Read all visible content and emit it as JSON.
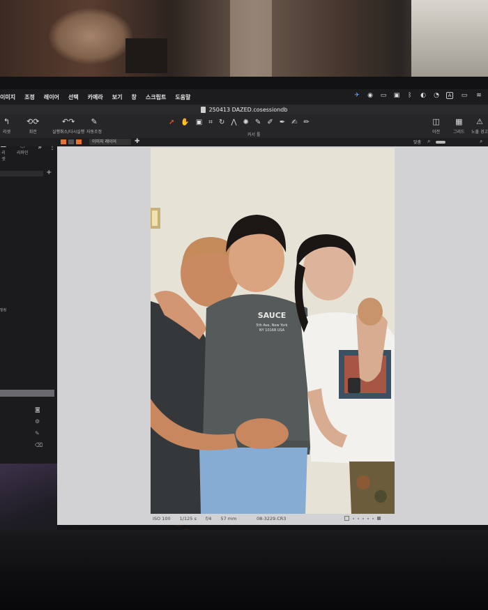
{
  "menubar": {
    "items": [
      "이미지",
      "조정",
      "레이어",
      "선택",
      "카메라",
      "보기",
      "창",
      "스크립트",
      "도움말"
    ],
    "status_icons": [
      "airplane-icon",
      "cc-icon",
      "display-icon",
      "battery-mode-icon",
      "bluetooth-icon",
      "playback-icon",
      "clock-icon",
      "input-icon",
      "battery-icon",
      "wifi-icon"
    ],
    "input_letter": "A"
  },
  "window": {
    "title": "250413 DAZED.cosessiondb"
  },
  "toolbar": {
    "tools": [
      {
        "name": "reset",
        "glyph": "↰",
        "label": "리셋"
      },
      {
        "name": "rotate",
        "glyph": "⟲⟳",
        "label": "회전"
      },
      {
        "name": "undo-redo",
        "glyph": "↶↷",
        "label": "실행취소/다시실행"
      },
      {
        "name": "auto-adjust",
        "glyph": "✎",
        "label": "자동조정"
      }
    ],
    "cursor_tools_label": "커서 툴",
    "right_tools": [
      {
        "name": "before",
        "glyph": "◫",
        "label": "이전"
      },
      {
        "name": "grid",
        "glyph": "▦",
        "label": "그리드"
      },
      {
        "name": "exposure-warning",
        "glyph": "⚠",
        "label": "노출 경고"
      }
    ]
  },
  "subbar": {
    "layer_select": "이미지 레이어",
    "fit_label": "맞춤"
  },
  "leftpanel": {
    "tool_a_label": "리셋",
    "tool_b_label": "리파인",
    "side_label": "밀링"
  },
  "photo": {
    "iso": "ISO 100",
    "shutter": "1/125 s",
    "aperture": "f/4",
    "focal": "57 mm",
    "filename": "08-3229.CR3",
    "shirt_text_1": "SAUCE",
    "shirt_text_2": "5th Ave, New York",
    "shirt_text_3": "NY 10168 USA"
  },
  "colors": {
    "accent": "#e6722e",
    "viewer_bg": "#d2d2d4",
    "panel_bg": "#1b1b1e",
    "toolbar_bg": "#262629"
  }
}
